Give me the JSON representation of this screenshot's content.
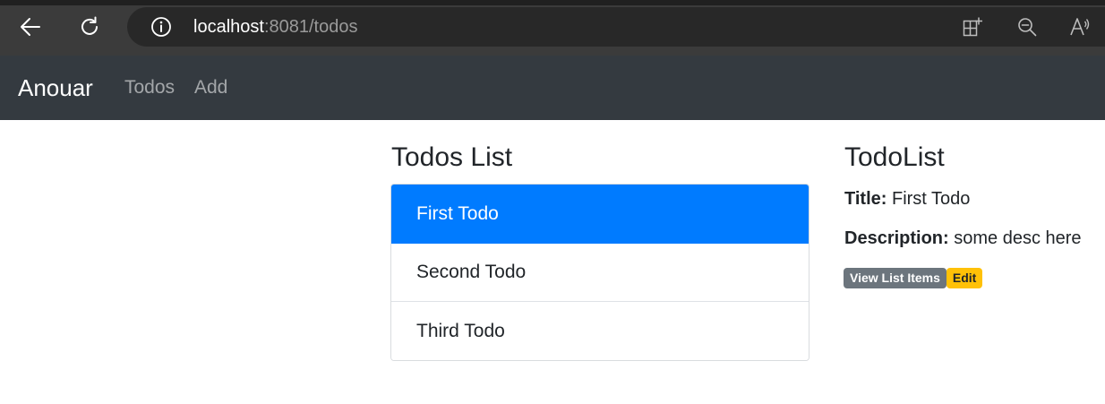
{
  "browser": {
    "url_host": "localhost",
    "url_rest": ":8081/todos",
    "icons": [
      "back-arrow-icon",
      "reload-icon",
      "info-icon",
      "extensions-icon",
      "zoom-out-icon",
      "read-aloud-icon"
    ]
  },
  "navbar": {
    "brand": "Anouar",
    "links": [
      "Todos",
      "Add"
    ]
  },
  "todos": {
    "heading": "Todos List",
    "items": [
      {
        "label": "First Todo",
        "active": true
      },
      {
        "label": "Second Todo",
        "active": false
      },
      {
        "label": "Third Todo",
        "active": false
      }
    ]
  },
  "detail": {
    "heading": "TodoList",
    "title_label": "Title:",
    "title_value": "First Todo",
    "description_label": "Description:",
    "description_value": "some desc here",
    "view_button": "View List Items",
    "edit_button": "Edit"
  },
  "colors": {
    "active_item": "#007bff",
    "navbar_bg": "#343a40",
    "view_badge": "#6c757d",
    "edit_badge": "#ffc107"
  }
}
